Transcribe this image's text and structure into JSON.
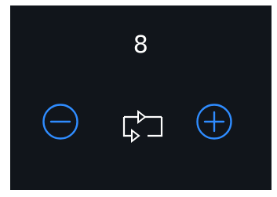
{
  "counter": {
    "value": "8"
  },
  "controls": {
    "decrement_icon": "minus-circle-icon",
    "repeat_icon": "repeat-icon",
    "increment_icon": "plus-circle-icon"
  },
  "colors": {
    "background": "#11151b",
    "text": "#ffffff",
    "accent": "#2f8cff",
    "icon_neutral": "#ffffff"
  }
}
